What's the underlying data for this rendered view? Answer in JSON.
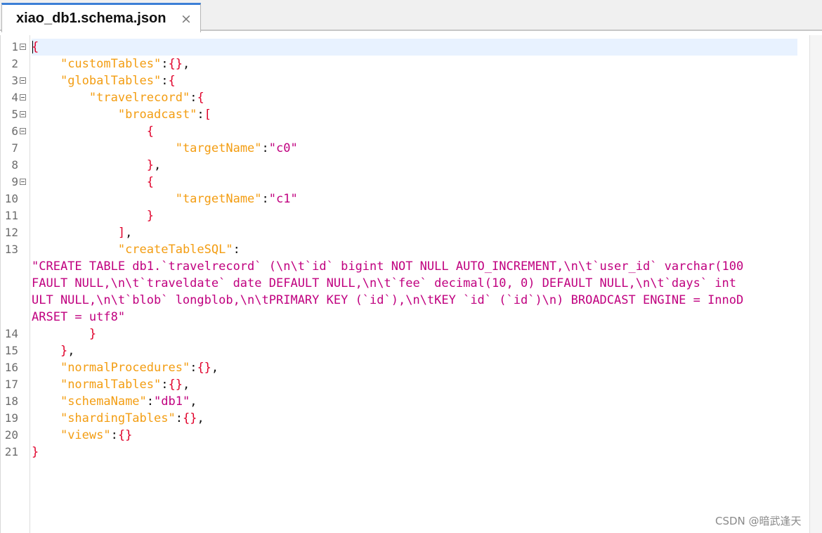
{
  "tab": {
    "title": "xiao_db1.schema.json",
    "close_glyph": "×"
  },
  "gutter": {
    "line_numbers": [
      "1",
      "2",
      "3",
      "4",
      "5",
      "6",
      "7",
      "8",
      "9",
      "10",
      "11",
      "12",
      "13",
      "14",
      "15",
      "16",
      "17",
      "18",
      "19",
      "20",
      "21"
    ]
  },
  "code": {
    "lines": [
      [
        [
          "p",
          "{"
        ]
      ],
      [
        [
          "t",
          "    "
        ],
        [
          "k",
          "\"customTables\""
        ],
        [
          "t",
          ":"
        ],
        [
          "p",
          "{}"
        ],
        [
          "t",
          ","
        ]
      ],
      [
        [
          "t",
          "    "
        ],
        [
          "k",
          "\"globalTables\""
        ],
        [
          "t",
          ":"
        ],
        [
          "p",
          "{"
        ]
      ],
      [
        [
          "t",
          "        "
        ],
        [
          "k",
          "\"travelrecord\""
        ],
        [
          "t",
          ":"
        ],
        [
          "p",
          "{"
        ]
      ],
      [
        [
          "t",
          "            "
        ],
        [
          "k",
          "\"broadcast\""
        ],
        [
          "t",
          ":"
        ],
        [
          "p",
          "["
        ]
      ],
      [
        [
          "t",
          "                "
        ],
        [
          "p",
          "{"
        ]
      ],
      [
        [
          "t",
          "                    "
        ],
        [
          "k",
          "\"targetName\""
        ],
        [
          "t",
          ":"
        ],
        [
          "s",
          "\"c0\""
        ]
      ],
      [
        [
          "t",
          "                "
        ],
        [
          "p",
          "}"
        ],
        [
          "t",
          ","
        ]
      ],
      [
        [
          "t",
          "                "
        ],
        [
          "p",
          "{"
        ]
      ],
      [
        [
          "t",
          "                    "
        ],
        [
          "k",
          "\"targetName\""
        ],
        [
          "t",
          ":"
        ],
        [
          "s",
          "\"c1\""
        ]
      ],
      [
        [
          "t",
          "                "
        ],
        [
          "p",
          "}"
        ]
      ],
      [
        [
          "t",
          "            "
        ],
        [
          "p",
          "]"
        ],
        [
          "t",
          ","
        ]
      ],
      [
        [
          "t",
          "            "
        ],
        [
          "k",
          "\"createTableSQL\""
        ],
        [
          "t",
          ":"
        ]
      ],
      [
        [
          "s",
          "\"CREATE TABLE db1.`travelrecord` (\\n\\t`id` bigint NOT NULL AUTO_INCREMENT,\\n\\t`user_id` varchar(100"
        ]
      ],
      [
        [
          "s",
          "FAULT NULL,\\n\\t`traveldate` date DEFAULT NULL,\\n\\t`fee` decimal(10, 0) DEFAULT NULL,\\n\\t`days` int"
        ]
      ],
      [
        [
          "s",
          "ULT NULL,\\n\\t`blob` longblob,\\n\\tPRIMARY KEY (`id`),\\n\\tKEY `id` (`id`)\\n) BROADCAST ENGINE = InnoD"
        ]
      ],
      [
        [
          "s",
          "ARSET = utf8\""
        ]
      ],
      [
        [
          "t",
          "        "
        ],
        [
          "p",
          "}"
        ]
      ],
      [
        [
          "t",
          "    "
        ],
        [
          "p",
          "}"
        ],
        [
          "t",
          ","
        ]
      ],
      [
        [
          "t",
          "    "
        ],
        [
          "k",
          "\"normalProcedures\""
        ],
        [
          "t",
          ":"
        ],
        [
          "p",
          "{}"
        ],
        [
          "t",
          ","
        ]
      ],
      [
        [
          "t",
          "    "
        ],
        [
          "k",
          "\"normalTables\""
        ],
        [
          "t",
          ":"
        ],
        [
          "p",
          "{}"
        ],
        [
          "t",
          ","
        ]
      ],
      [
        [
          "t",
          "    "
        ],
        [
          "k",
          "\"schemaName\""
        ],
        [
          "t",
          ":"
        ],
        [
          "s",
          "\"db1\""
        ],
        [
          "t",
          ","
        ]
      ],
      [
        [
          "t",
          "    "
        ],
        [
          "k",
          "\"shardingTables\""
        ],
        [
          "t",
          ":"
        ],
        [
          "p",
          "{}"
        ],
        [
          "t",
          ","
        ]
      ],
      [
        [
          "t",
          "    "
        ],
        [
          "k",
          "\"views\""
        ],
        [
          "t",
          ":"
        ],
        [
          "p",
          "{}"
        ]
      ],
      [
        [
          "p",
          "}"
        ]
      ]
    ]
  },
  "watermark": "CSDN @暗武逢天",
  "colors": {
    "key": "#f39d12",
    "bracket": "#e0002a",
    "string": "#c0007f",
    "tab_accent": "#3c7fd6"
  }
}
